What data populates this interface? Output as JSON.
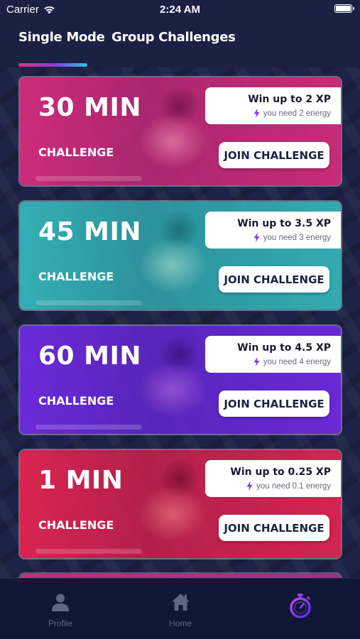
{
  "status_bar": {
    "carrier": "Carrier",
    "time": "2:24 AM"
  },
  "tabs": [
    {
      "label": "Single Mode",
      "active": true
    },
    {
      "label": "Group Challenges",
      "active": false
    }
  ],
  "colors": {
    "background": "#1c2346",
    "tab_indicator": [
      "#e0307f",
      "#8a3cd8",
      "#2fc6e0"
    ],
    "nav_active": "#8a3cf0"
  },
  "cards": [
    {
      "title": "30 MIN",
      "subtitle": "CHALLENGE",
      "xp": "Win up to 2 XP",
      "energy": "you need 2 energy",
      "button": "JOIN CHALLENGE",
      "color": "#d12d7e"
    },
    {
      "title": "45 MIN",
      "subtitle": "CHALLENGE",
      "xp": "Win up to 3.5 XP",
      "energy": "you need 3 energy",
      "button": "JOIN CHALLENGE",
      "color": "#32b5b8"
    },
    {
      "title": "60 MIN",
      "subtitle": "CHALLENGE",
      "xp": "Win up to 4.5 XP",
      "energy": "you need 4 energy",
      "button": "JOIN CHALLENGE",
      "color": "#6d2be0"
    },
    {
      "title": "1 MIN",
      "subtitle": "CHALLENGE",
      "xp": "Win up to 0.25 XP",
      "energy": "you need 0.1 energy",
      "button": "JOIN CHALLENGE",
      "color": "#e0244f"
    }
  ],
  "bottom_nav": [
    {
      "label": "Profile",
      "icon": "person-icon",
      "active": false
    },
    {
      "label": "Home",
      "icon": "home-icon",
      "active": false
    },
    {
      "label": "",
      "icon": "stopwatch-icon",
      "active": true
    }
  ]
}
